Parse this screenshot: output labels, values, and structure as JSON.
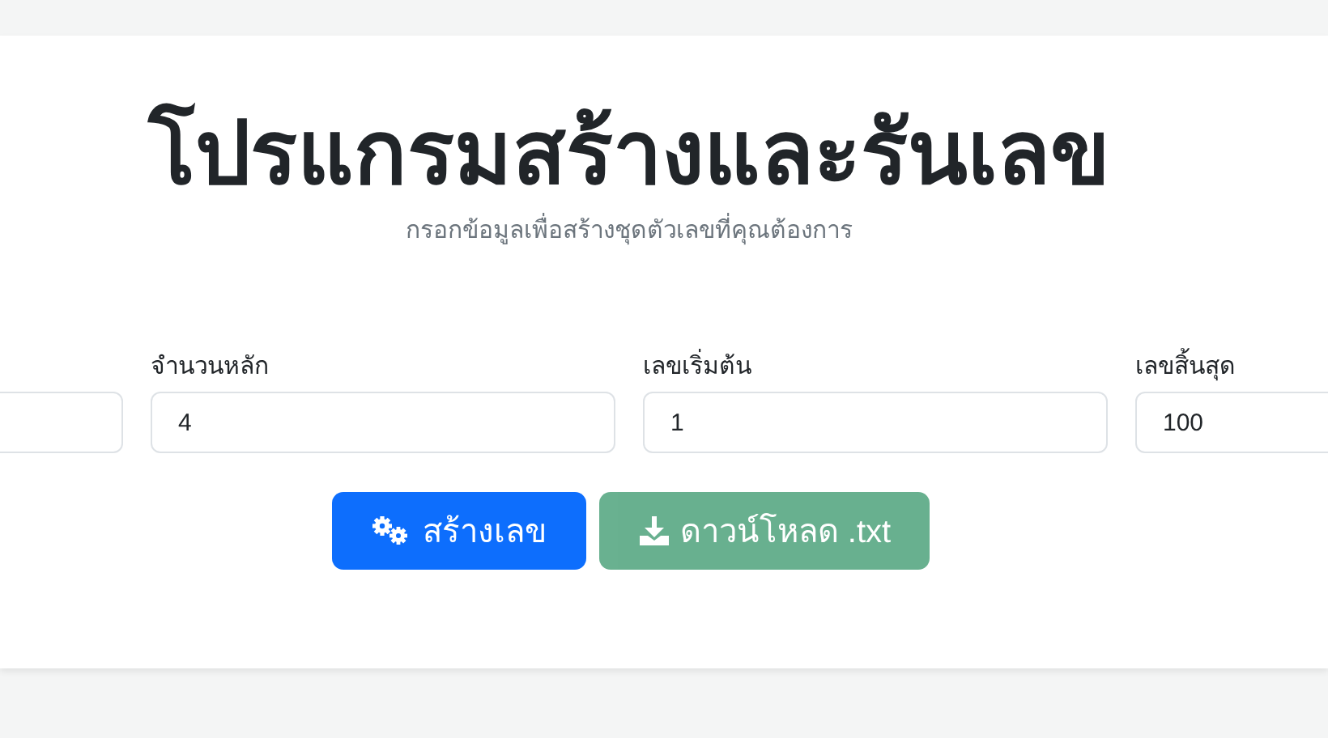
{
  "title": "โปรแกรมสร้างและรันเลข",
  "subtitle": "กรอกข้อมูลเพื่อสร้างชุดตัวเลขที่คุณต้องการ",
  "fields": [
    {
      "label": "จำนวนหลัก",
      "value": "4"
    },
    {
      "label": "เลขเริ่มต้น",
      "value": "1"
    },
    {
      "label": "เลขสิ้นสุด",
      "value": "100"
    }
  ],
  "buttons": [
    {
      "kind": "generate",
      "label": "สร้างเลข",
      "disabled": false
    },
    {
      "kind": "download",
      "label": "ดาวน์โหลด .txt",
      "disabled": true
    }
  ]
}
